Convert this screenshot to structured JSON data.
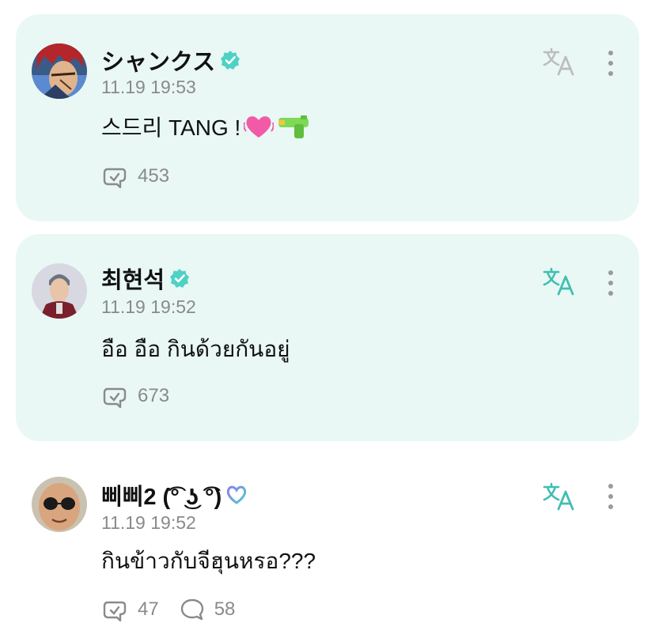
{
  "colors": {
    "card_highlight": "#e9f8f5",
    "accent_teal": "#3fbfb0",
    "muted_text": "#8a8a8a",
    "verified_badge": "#4fd1c5",
    "heart_pink": "#f25aa8",
    "gun_green": "#7ed957"
  },
  "posts": [
    {
      "username": "シャンクス",
      "verified": true,
      "timestamp": "11.19 19:53",
      "text": "스드리 TANG !",
      "emojis": [
        "heart-icon",
        "water-pistol-icon"
      ],
      "reposts": "453",
      "highlighted": true
    },
    {
      "username": "최현석",
      "verified": true,
      "timestamp": "11.19 19:52",
      "text": "อือ อือ กินด้วยกันอยู่",
      "reposts": "673",
      "highlighted": true
    },
    {
      "username": "삐삐2 (͡° ͜ʖ ͡°)",
      "verified": false,
      "badge": "heart-badge-icon",
      "timestamp": "11.19 19:52",
      "text": "กินข้าวกับจีฮุนหรอ???",
      "reposts": "47",
      "comments": "58",
      "highlighted": false
    }
  ]
}
